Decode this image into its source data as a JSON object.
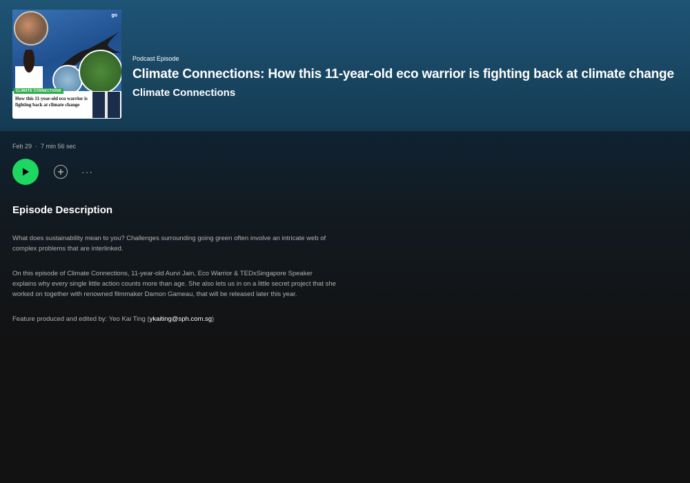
{
  "episode": {
    "eyebrow": "Podcast Episode",
    "title": "Climate Connections: How this 11-year-old eco warrior is fighting back at climate change",
    "show": "Climate Connections",
    "date": "Feb 29",
    "separator": "·",
    "duration": "7 min 56 sec"
  },
  "cover": {
    "badge": "CLIMATE CONNECTIONS",
    "title": "How this 11-year-old eco warrior is fighting back at climate change",
    "logo": "go"
  },
  "controls": {
    "play_icon": "play-icon",
    "add_icon": "plus-circle-icon",
    "more_label": "···"
  },
  "description": {
    "heading": "Episode Description",
    "paragraph1": "What does sustainability mean to you? Challenges surrounding going green often involve an intricate web of complex problems that are interlinked.",
    "paragraph2": "On this episode of Climate Connections, 11-year-old Aurvi Jain, Eco Warrior & TEDxSingapore Speaker explains why every single little action counts more than age. She also lets us in on a little secret project that she worked on together with renowned filmmaker Damon Gameau, that will be released later this year.",
    "credit_prefix": "Feature produced and edited by: Yeo Kai Ting (",
    "credit_email": "ykaiting@sph.com.sg",
    "credit_suffix": ")"
  },
  "colors": {
    "accent": "#1ed760",
    "hero": "#1f5475",
    "background": "#121212"
  }
}
